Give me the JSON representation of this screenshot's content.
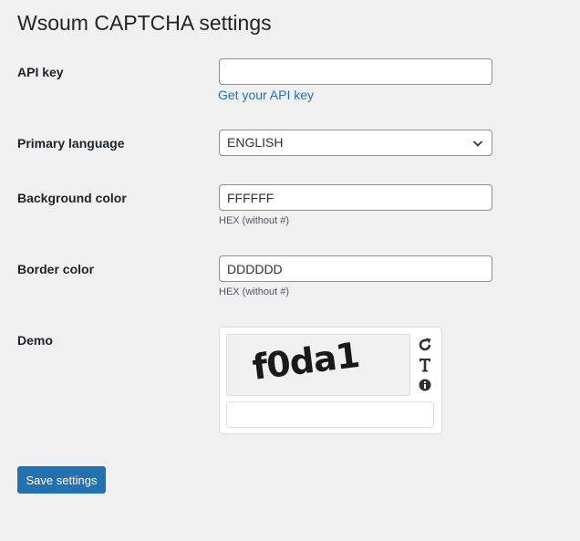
{
  "page": {
    "title": "Wsoum CAPTCHA settings"
  },
  "fields": {
    "api_key": {
      "label": "API key",
      "value": "",
      "link_text": "Get your API key"
    },
    "primary_language": {
      "label": "Primary language",
      "value": "ENGLISH"
    },
    "background_color": {
      "label": "Background color",
      "value": "FFFFFF",
      "hint": "HEX (without #)"
    },
    "border_color": {
      "label": "Border color",
      "value": "DDDDDD",
      "hint": "HEX (without #)"
    },
    "demo": {
      "label": "Demo",
      "captcha_text": "f0da1",
      "icons": [
        "refresh-icon",
        "text-icon",
        "info-icon"
      ]
    }
  },
  "actions": {
    "save_label": "Save settings"
  },
  "colors": {
    "accent": "#2271b1",
    "background": "#f0f0f1",
    "text": "#1d2327"
  }
}
